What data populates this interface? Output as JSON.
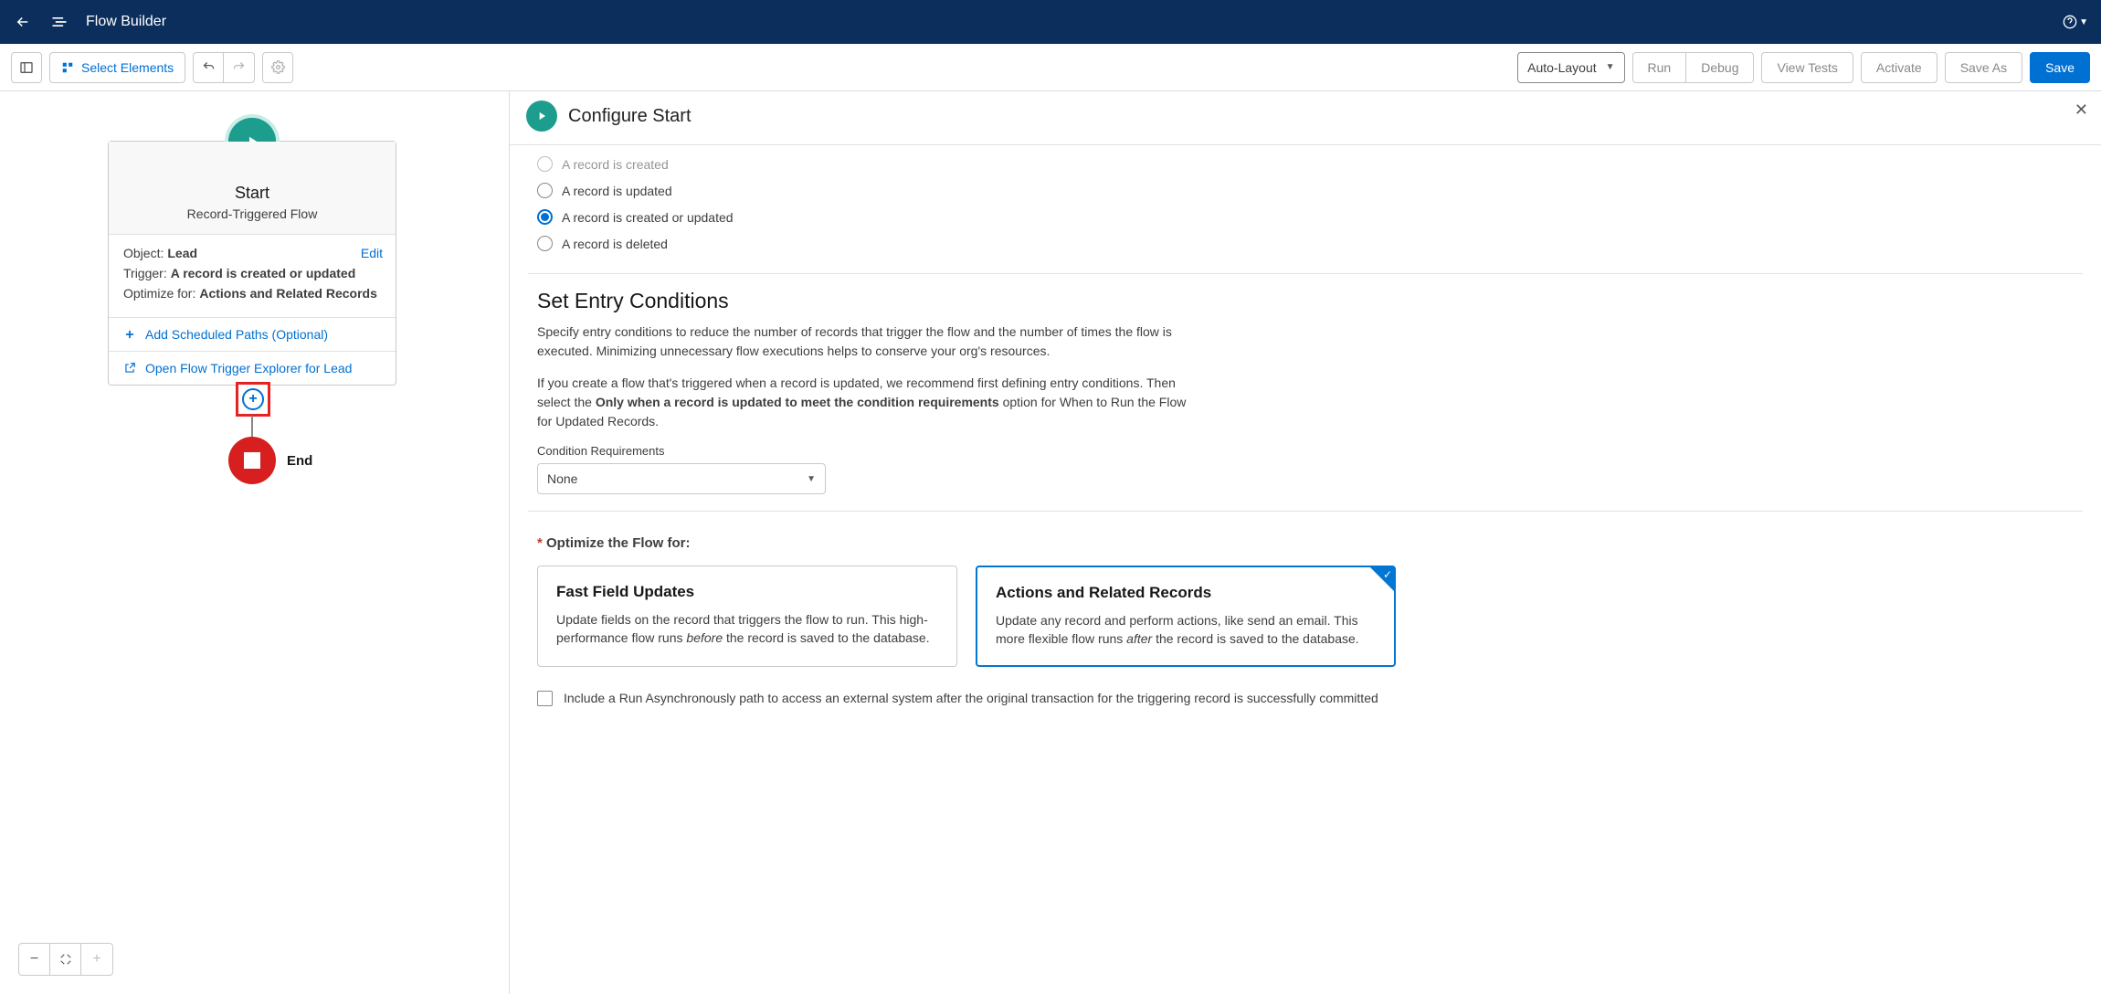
{
  "header": {
    "title": "Flow Builder"
  },
  "toolbar": {
    "selectElements": "Select Elements",
    "layout": "Auto-Layout",
    "buttons": {
      "run": "Run",
      "debug": "Debug",
      "viewTests": "View Tests",
      "activate": "Activate",
      "saveAs": "Save As",
      "save": "Save"
    }
  },
  "canvas": {
    "startCard": {
      "title": "Start",
      "subtitle": "Record-Triggered Flow",
      "objectLabel": "Object:",
      "objectValue": "Lead",
      "triggerLabel": "Trigger:",
      "triggerValue": "A record is created or updated",
      "optimizeLabel": "Optimize for:",
      "optimizeValue": "Actions and Related Records",
      "editLink": "Edit",
      "addSchedule": "Add Scheduled Paths (Optional)",
      "openExplorer": "Open Flow Trigger Explorer for Lead"
    },
    "endLabel": "End"
  },
  "panel": {
    "title": "Configure Start",
    "radios": {
      "created": "A record is created",
      "updated": "A record is updated",
      "createdOrUpdated": "A record is created or updated",
      "deleted": "A record is deleted"
    },
    "entry": {
      "heading": "Set Entry Conditions",
      "para1": "Specify entry conditions to reduce the number of records that trigger the flow and the number of times the flow is executed. Minimizing unnecessary flow executions helps to conserve your org's resources.",
      "para2a": "If you create a flow that's triggered when a record is updated, we recommend first defining entry conditions. Then select the ",
      "para2bold": "Only when a record is updated to meet the condition requirements",
      "para2b": " option for When to Run the Flow for Updated Records.",
      "conditionLabel": "Condition Requirements",
      "conditionValue": "None"
    },
    "optimize": {
      "heading": "Optimize the Flow for:",
      "card1Title": "Fast Field Updates",
      "card1DescA": "Update fields on the record that triggers the flow to run. This high-performance flow runs ",
      "card1Ital": "before",
      "card1DescB": " the record is saved to the database.",
      "card2Title": "Actions and Related Records",
      "card2DescA": "Update any record and perform actions, like send an email. This more flexible flow runs ",
      "card2Ital": "after",
      "card2DescB": " the record is saved to the database."
    },
    "asyncText": "Include a Run Asynchronously path to access an external system after the original transaction for the triggering record is successfully committed"
  }
}
